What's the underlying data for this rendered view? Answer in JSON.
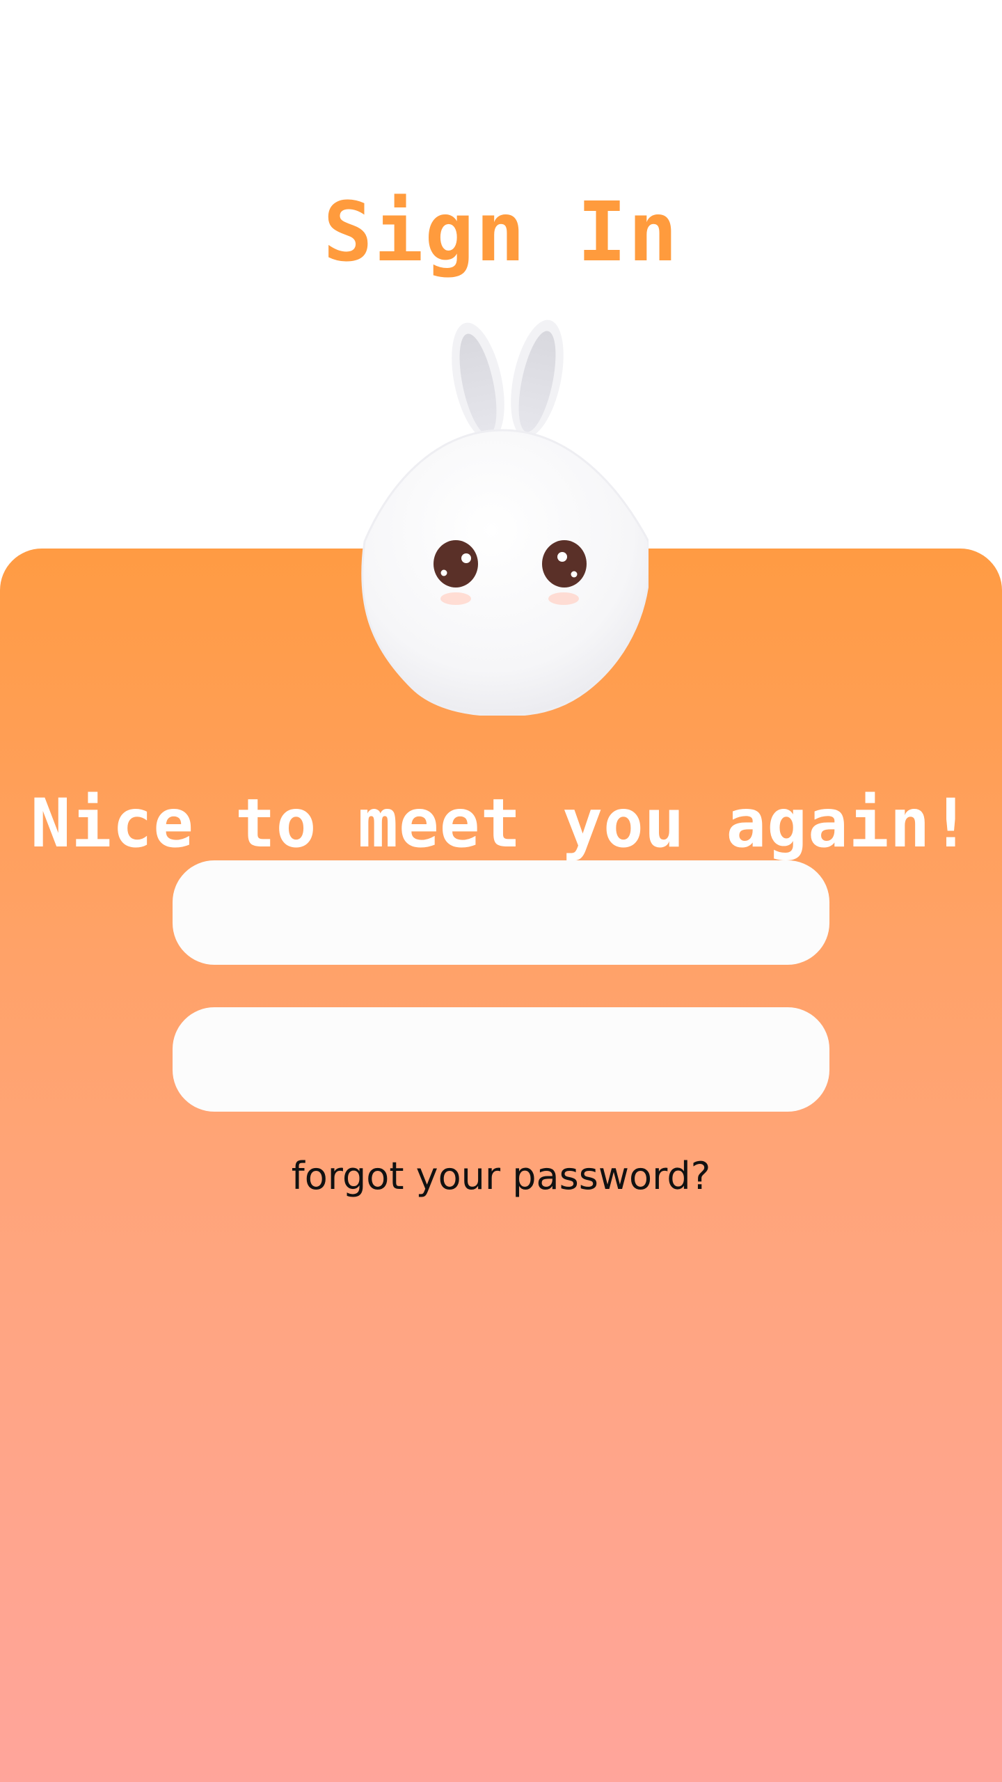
{
  "header": {
    "title": "Sign In"
  },
  "mascot": {
    "icon": "bunny-icon"
  },
  "main": {
    "greeting": "Nice to meet you again!",
    "email_field": {
      "value": "",
      "placeholder": ""
    },
    "password_field": {
      "value": "",
      "placeholder": ""
    },
    "forgot_password_link": "forgot your password?"
  },
  "colors": {
    "accent": "#ff9b3d",
    "gradient_top": "#ff9b43",
    "gradient_bottom": "#ffa59b",
    "field_background": "#fcfcfc",
    "text_on_accent": "#ffffff"
  }
}
